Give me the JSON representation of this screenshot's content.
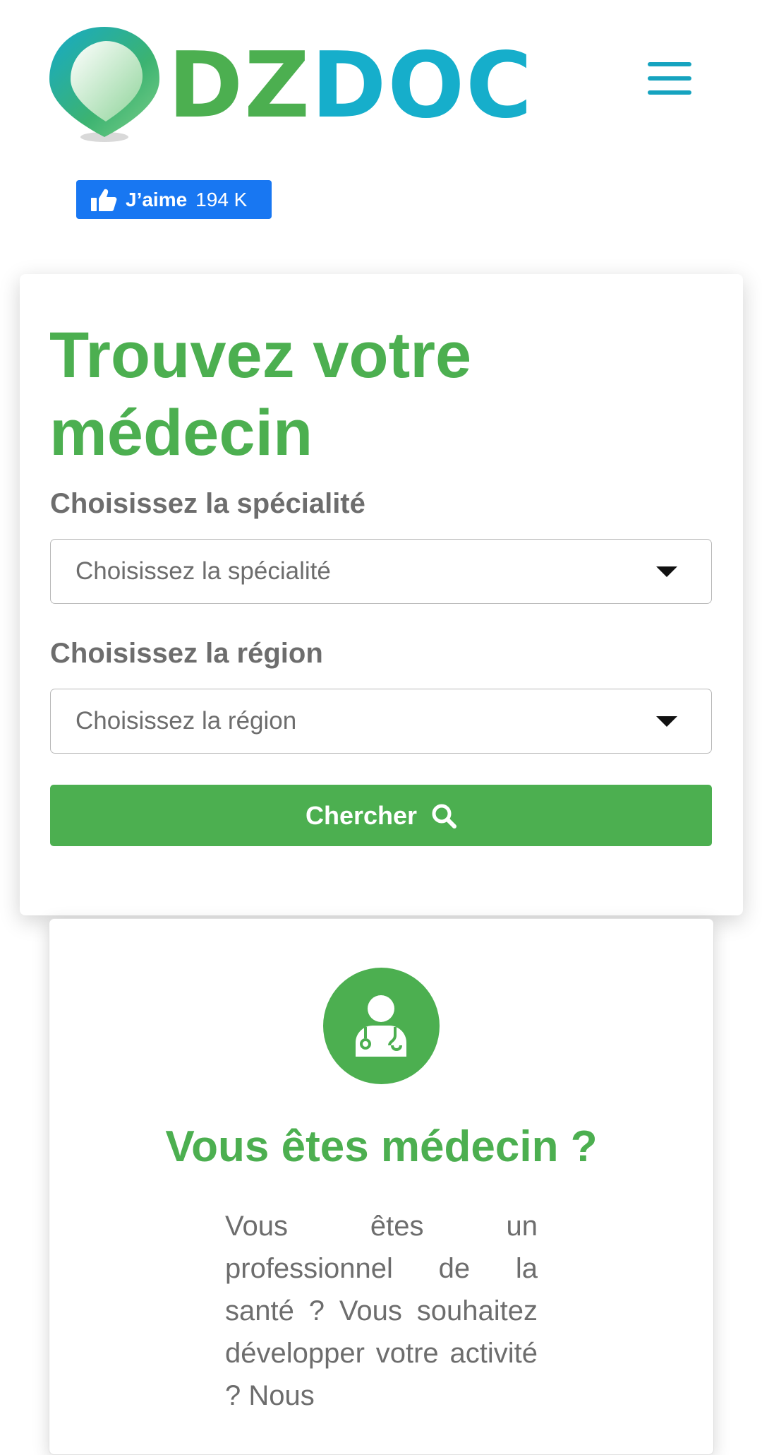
{
  "header": {
    "logo": {
      "part1": "DZ",
      "part2": "DOC"
    },
    "menu_icon": "hamburger-menu-icon",
    "facebook_like": {
      "icon": "thumbs-up-icon",
      "label": "J’aime",
      "count": "194 K"
    }
  },
  "search": {
    "title": "Trouvez votre médecin",
    "specialty": {
      "label": "Choisissez la spécialité",
      "selected": "Choisissez la spécialité"
    },
    "region": {
      "label": "Choisissez la région",
      "selected": "Choisissez la région"
    },
    "button": {
      "label": "Chercher",
      "icon": "search-icon"
    }
  },
  "doctor_promo": {
    "icon": "doctor-icon",
    "title": "Vous êtes médecin ?",
    "text": "Vous êtes un professionnel de la santé ? Vous souhaitez développer votre activité ? Nous"
  },
  "colors": {
    "brand_green": "#4caf50",
    "brand_blue": "#16aecb",
    "facebook_blue": "#1877f2",
    "text_gray": "#6d6d6d"
  }
}
